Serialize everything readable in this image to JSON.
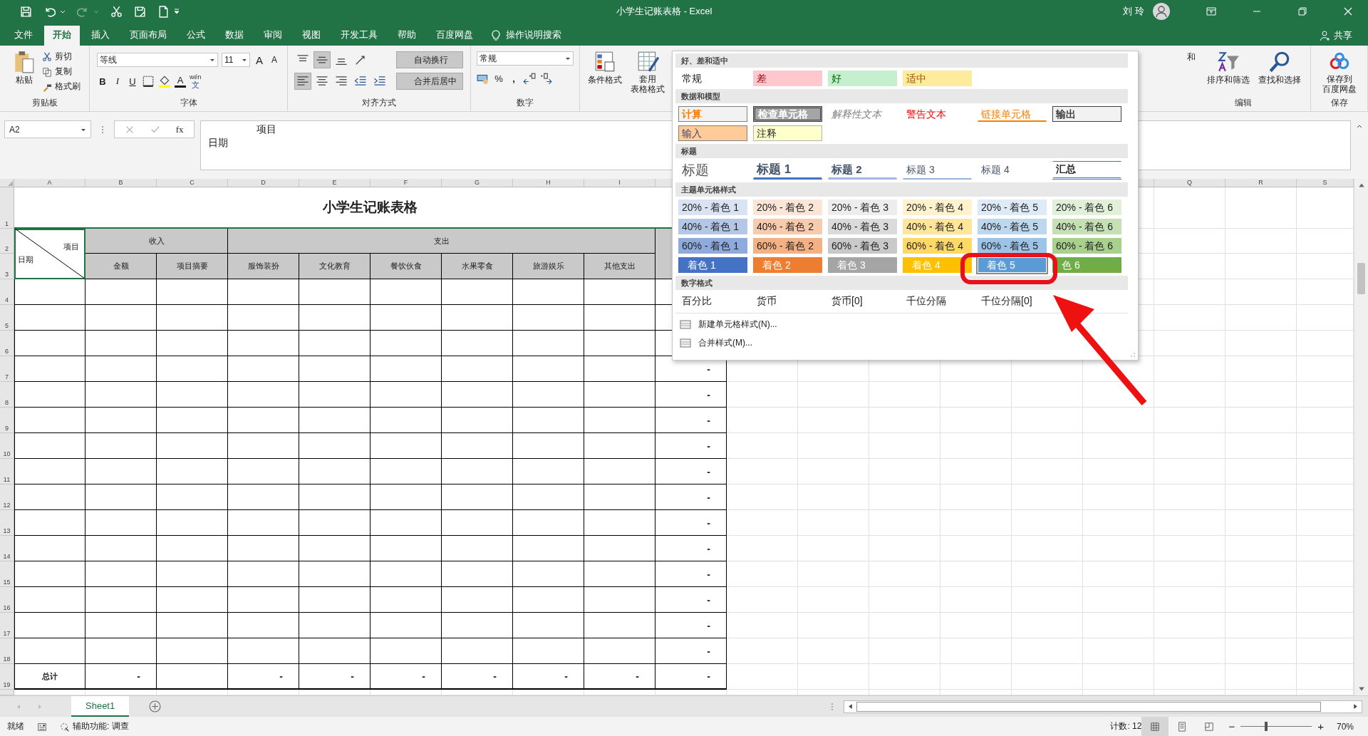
{
  "window": {
    "title": "小学生记账表格  -  Excel",
    "user": "刘 玲"
  },
  "tabs": [
    {
      "label": "文件",
      "selected": false
    },
    {
      "label": "开始",
      "selected": true
    },
    {
      "label": "插入",
      "selected": false
    },
    {
      "label": "页面布局",
      "selected": false
    },
    {
      "label": "公式",
      "selected": false
    },
    {
      "label": "数据",
      "selected": false
    },
    {
      "label": "审阅",
      "selected": false
    },
    {
      "label": "视图",
      "selected": false
    },
    {
      "label": "开发工具",
      "selected": false
    },
    {
      "label": "帮助",
      "selected": false
    },
    {
      "label": "百度网盘",
      "selected": false
    }
  ],
  "tell_me": "操作说明搜索",
  "share": "共享",
  "ribbon": {
    "clipboard": {
      "paste": "粘贴",
      "cut": "剪切",
      "copy": "复制",
      "format_painter": "格式刷",
      "label": "剪贴板"
    },
    "font": {
      "name": "等线",
      "size": "11",
      "grow": "A",
      "shrink": "A",
      "bold": "B",
      "italic": "I",
      "underline": "U",
      "font_color": "A",
      "phonetic": [
        "wén",
        "文"
      ],
      "label": "字体"
    },
    "alignment": {
      "vertical": [
        {
          "selected": false
        },
        {
          "selected": true
        },
        {
          "selected": false
        }
      ],
      "horizontal": [
        {
          "selected": true
        },
        {
          "selected": false
        },
        {
          "selected": false
        }
      ],
      "wrap_text": {
        "label": "自动换行",
        "on": true
      },
      "merge_center": {
        "label": "合并后居中",
        "on": true
      },
      "label": "对齐方式"
    },
    "number": {
      "format": "常规",
      "percent": "%",
      "comma": ",",
      "label": "数字"
    },
    "styles": {
      "conditional": "条件格式",
      "format_table": [
        "套用",
        "表格格式"
      ]
    },
    "editing": {
      "sum_partial": "和",
      "sort_filter": "排序和筛选",
      "find_select": "查找和选择",
      "label": "编辑"
    },
    "save": {
      "button": [
        "保存到",
        "百度网盘"
      ],
      "label": "保存"
    }
  },
  "formula_bar": {
    "name_box": "A2",
    "function_button": "fx",
    "value_lines": [
      "项目",
      "日期"
    ]
  },
  "columns": [
    "A",
    "B",
    "C",
    "D",
    "E",
    "F",
    "G",
    "H",
    "I",
    "Q",
    "R",
    "S"
  ],
  "sheet": {
    "title_row": {
      "row": "1",
      "title": "小学生记账表格"
    },
    "header_rows": [
      "2",
      "3"
    ],
    "corner": {
      "top": "项目",
      "bottom": "日期",
      "selected": true
    },
    "groups": [
      "收入",
      "支出"
    ],
    "subheaders": [
      "金额",
      "项目摘要",
      "服饰装扮",
      "文化教育",
      "餐饮伙食",
      "水果零食",
      "旅游娱乐",
      "其他支出"
    ],
    "rows": [
      {
        "row": "4"
      },
      {
        "row": "5"
      },
      {
        "row": "6"
      },
      {
        "row": "7",
        "column_10": "-"
      },
      {
        "row": "8",
        "column_10": "-"
      },
      {
        "row": "9",
        "column_10": "-"
      },
      {
        "row": "10",
        "column_10": "-"
      },
      {
        "row": "11",
        "column_10": "-"
      },
      {
        "row": "12",
        "column_10": "-"
      },
      {
        "row": "13",
        "column_10": "-"
      },
      {
        "row": "14",
        "column_10": "-"
      },
      {
        "row": "15",
        "column_10": "-"
      },
      {
        "row": "16",
        "column_10": "-"
      },
      {
        "row": "17",
        "column_10": "-"
      },
      {
        "row": "18",
        "column_10": "-"
      }
    ],
    "total": {
      "row": "19",
      "label": "总计",
      "income_amount": "-",
      "expenses": [
        "-",
        "-",
        "-",
        "-",
        "-",
        "-"
      ],
      "column_10": "-"
    }
  },
  "sheet_tabs": [
    {
      "label": "Sheet1",
      "selected": true
    }
  ],
  "status_bar": {
    "ready": "就绪",
    "accessibility": "辅助功能: 调查",
    "count": "计数: 12",
    "zoom": "70%",
    "zoom_out": "−",
    "zoom_in": "+",
    "zoom_slider": {
      "level": 0.34
    },
    "views": [
      {
        "selected": true
      },
      {
        "selected": false
      },
      {
        "selected": false
      }
    ]
  },
  "cell_styles": {
    "sections": [
      {
        "title": "好、差和适中",
        "items": [
          {
            "label": "常规",
            "kind": "normal",
            "selected": false
          },
          {
            "label": "差",
            "kind": "bad",
            "selected": false
          },
          {
            "label": "好",
            "kind": "good",
            "selected": false
          },
          {
            "label": "适中",
            "kind": "neutral",
            "selected": false
          }
        ]
      },
      {
        "title": "数据和模型",
        "items": [
          {
            "label": "计算",
            "kind": "calc",
            "selected": false
          },
          {
            "label": "检查单元格",
            "kind": "check",
            "selected": false
          },
          {
            "label": "解释性文本",
            "kind": "explanatory",
            "selected": false
          },
          {
            "label": "警告文本",
            "kind": "warning",
            "selected": false
          },
          {
            "label": "链接单元格",
            "kind": "linked",
            "selected": false
          },
          {
            "label": "输出",
            "kind": "output",
            "selected": false
          },
          {
            "label": "输入",
            "kind": "input",
            "selected": false
          },
          {
            "label": "注释",
            "kind": "note",
            "selected": false
          }
        ]
      },
      {
        "title": "标题",
        "items": [
          {
            "label": "标题",
            "kind": "title",
            "selected": false
          },
          {
            "label": "标题 1",
            "kind": "heading1",
            "selected": false
          },
          {
            "label": "标题 2",
            "kind": "heading2",
            "selected": false
          },
          {
            "label": "标题 3",
            "kind": "heading3",
            "selected": false
          },
          {
            "label": "标题 4",
            "kind": "heading4",
            "selected": false
          },
          {
            "label": "汇总",
            "kind": "total",
            "selected": false
          }
        ]
      },
      {
        "title": "主题单元格样式",
        "items": [
          {
            "label": "20% - 着色 1",
            "kind": "tint",
            "color": "#dae3f3",
            "selected": false
          },
          {
            "label": "20% - 着色 2",
            "kind": "tint",
            "color": "#fbe5d6",
            "selected": false
          },
          {
            "label": "20% - 着色 3",
            "kind": "tint",
            "color": "#ededed",
            "selected": false
          },
          {
            "label": "20% - 着色 4",
            "kind": "tint",
            "color": "#fff2cc",
            "selected": false
          },
          {
            "label": "20% - 着色 5",
            "kind": "tint",
            "color": "#deebf7",
            "selected": false
          },
          {
            "label": "20% - 着色 6",
            "kind": "tint",
            "color": "#e2f0d9",
            "selected": false
          },
          {
            "label": "40% - 着色 1",
            "kind": "tint",
            "color": "#b4c7e7",
            "selected": false
          },
          {
            "label": "40% - 着色 2",
            "kind": "tint",
            "color": "#f8cbad",
            "selected": false
          },
          {
            "label": "40% - 着色 3",
            "kind": "tint",
            "color": "#dbdbdb",
            "selected": false
          },
          {
            "label": "40% - 着色 4",
            "kind": "tint",
            "color": "#ffe699",
            "selected": false
          },
          {
            "label": "40% - 着色 5",
            "kind": "tint",
            "color": "#bdd7ee",
            "selected": false
          },
          {
            "label": "40% - 着色 6",
            "kind": "tint",
            "color": "#c5e0b4",
            "selected": false
          },
          {
            "label": "60% - 着色 1",
            "kind": "tint",
            "color": "#8faadc",
            "selected": false
          },
          {
            "label": "60% - 着色 2",
            "kind": "tint",
            "color": "#f4b183",
            "selected": false
          },
          {
            "label": "60% - 着色 3",
            "kind": "tint",
            "color": "#c9c9c9",
            "selected": false
          },
          {
            "label": "60% - 着色 4",
            "kind": "tint",
            "color": "#ffd966",
            "selected": false
          },
          {
            "label": "60% - 着色 5",
            "kind": "tint",
            "color": "#9dc3e6",
            "selected": false
          },
          {
            "label": "60% - 着色 6",
            "kind": "tint",
            "color": "#a9d18e",
            "selected": false
          },
          {
            "label": "着色 1",
            "kind": "accent",
            "color": "#4472c4",
            "selected": false
          },
          {
            "label": "着色 2",
            "kind": "accent",
            "color": "#ed7d31",
            "selected": false
          },
          {
            "label": "着色 3",
            "kind": "accent",
            "color": "#a5a5a5",
            "selected": false
          },
          {
            "label": "着色 4",
            "kind": "accent",
            "color": "#ffc000",
            "selected": false
          },
          {
            "label": "着色 5",
            "kind": "accent",
            "color": "#5b9bd5",
            "selected": true
          },
          {
            "label": "色 6",
            "kind": "accent",
            "color": "#70ad47",
            "selected": false
          }
        ]
      },
      {
        "title": "数字格式",
        "items": [
          {
            "label": "百分比",
            "kind": "normal",
            "selected": false
          },
          {
            "label": "货币",
            "kind": "normal",
            "selected": false
          },
          {
            "label": "货币[0]",
            "kind": "normal",
            "selected": false
          },
          {
            "label": "千位分隔",
            "kind": "normal",
            "selected": false
          },
          {
            "label": "千位分隔[0]",
            "kind": "normal",
            "selected": false
          }
        ]
      }
    ],
    "commands": [
      "新建单元格样式(N)...",
      "合并样式(M)..."
    ]
  }
}
